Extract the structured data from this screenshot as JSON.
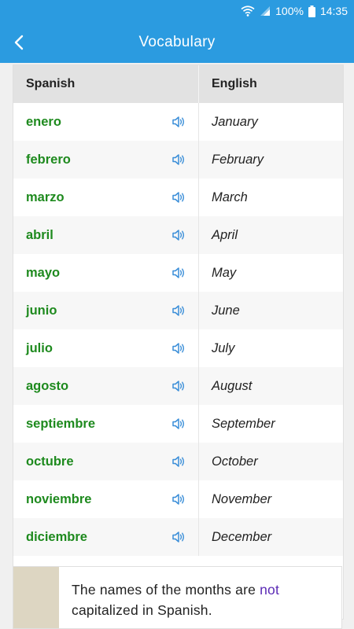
{
  "status_bar": {
    "battery_percent": "100%",
    "time": "14:35",
    "icons": [
      "wifi-icon",
      "signal-icon",
      "battery-icon"
    ]
  },
  "app_bar": {
    "title": "Vocabulary",
    "back_icon": "chevron-left-icon"
  },
  "table": {
    "headers": {
      "spanish": "Spanish",
      "english": "English"
    },
    "rows": [
      {
        "spanish": "enero",
        "english": "January"
      },
      {
        "spanish": "febrero",
        "english": "February"
      },
      {
        "spanish": "marzo",
        "english": "March"
      },
      {
        "spanish": "abril",
        "english": "April"
      },
      {
        "spanish": "mayo",
        "english": "May"
      },
      {
        "spanish": "junio",
        "english": "June"
      },
      {
        "spanish": "julio",
        "english": "July"
      },
      {
        "spanish": "agosto",
        "english": "August"
      },
      {
        "spanish": "septiembre",
        "english": "September"
      },
      {
        "spanish": "octubre",
        "english": "October"
      },
      {
        "spanish": "noviembre",
        "english": "November"
      },
      {
        "spanish": "diciembre",
        "english": "December"
      }
    ]
  },
  "note": {
    "text_before": "The names of the months are ",
    "highlight": "not",
    "text_after": " capitalized in Spanish."
  },
  "colors": {
    "primary": "#2b9be0",
    "spanish_word": "#1e8a1e",
    "highlight": "#5b2bb5",
    "note_bar": "#ddd6c2"
  }
}
